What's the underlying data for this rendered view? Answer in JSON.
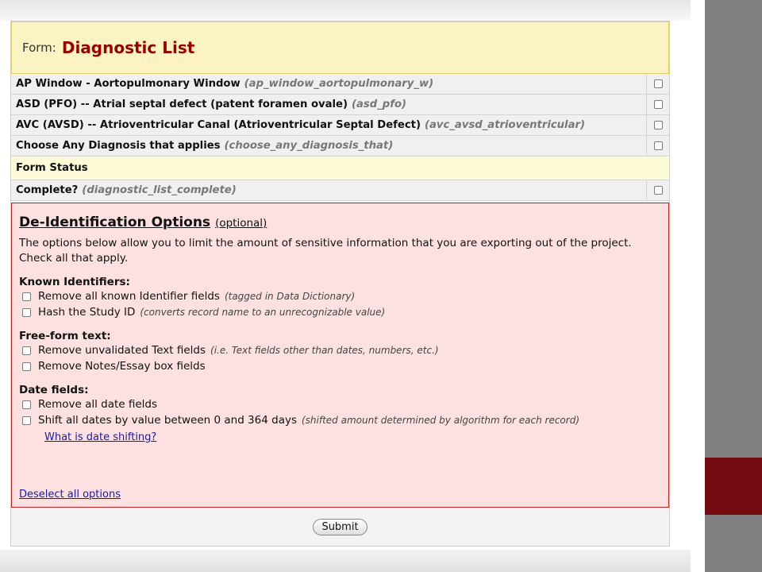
{
  "form": {
    "prefix": "Form:",
    "title": "Diagnostic List",
    "fields": [
      {
        "label": "AP Window - Aortopulmonary Window",
        "variable": "(ap_window_aortopulmonary_w)",
        "checked": false
      },
      {
        "label": "ASD (PFO) -- Atrial septal defect (patent foramen ovale)",
        "variable": "(asd_pfo)",
        "checked": false
      },
      {
        "label": "AVC (AVSD) -- Atrioventricular Canal (Atrioventricular Septal Defect)",
        "variable": "(avc_avsd_atrioventricular)",
        "checked": false
      },
      {
        "label": "Choose Any Diagnosis that applies",
        "variable": "(choose_any_diagnosis_that)",
        "checked": false
      }
    ],
    "status_header": "Form Status",
    "status_field": {
      "label": "Complete?",
      "variable": "(diagnostic_list_complete)",
      "checked": false
    }
  },
  "deid": {
    "title": "De-Identification Options",
    "optional": "(optional)",
    "description": "The options below allow you to limit the amount of sensitive information that you are exporting out of the project. Check all that apply.",
    "known_identifiers": {
      "heading": "Known Identifiers:",
      "options": [
        {
          "label": "Remove all known Identifier fields",
          "note": "(tagged in Data Dictionary)"
        },
        {
          "label": "Hash the Study ID",
          "note": "(converts record name to an unrecognizable value)"
        }
      ]
    },
    "free_form": {
      "heading": "Free-form text:",
      "options": [
        {
          "label": "Remove unvalidated Text fields",
          "note": "(i.e. Text fields other than dates, numbers, etc.)"
        },
        {
          "label": "Remove Notes/Essay box fields",
          "note": ""
        }
      ]
    },
    "date_fields": {
      "heading": "Date fields:",
      "options": [
        {
          "label": "Remove all date fields",
          "note": ""
        },
        {
          "label": "Shift all dates by value between 0 and 364 days",
          "note": "(shifted amount determined by algorithm for each record)"
        }
      ],
      "help_link": "What is date shifting?"
    },
    "deselect_link": "Deselect all options"
  },
  "submit_label": "Submit",
  "colors": {
    "title_red": "#990000",
    "header_yellow": "#fbf4c2",
    "deid_pink": "#fde1e1",
    "deid_border": "#c62020",
    "side_gray": "#7f7f7f",
    "side_accent": "#740b10",
    "link_blue": "#1a1aa8"
  }
}
